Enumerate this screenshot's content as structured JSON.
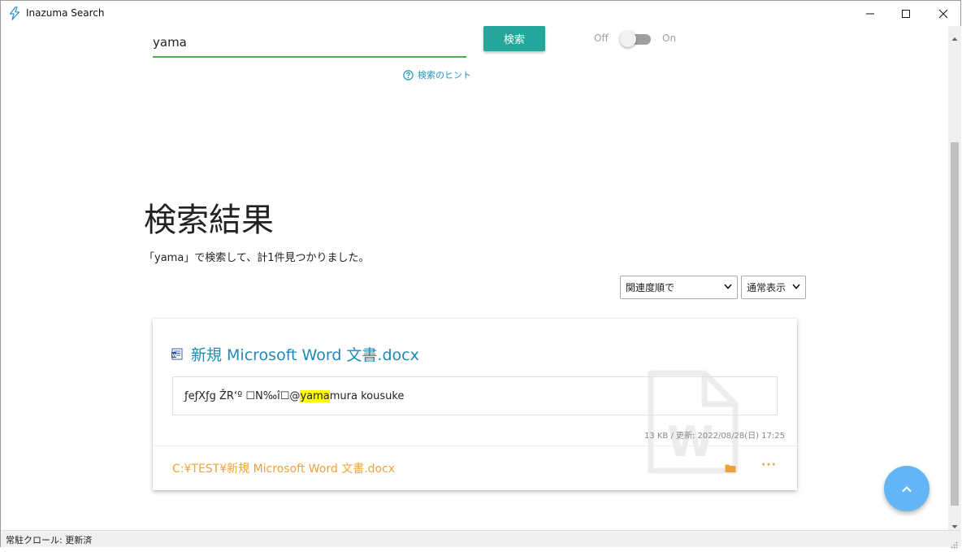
{
  "window": {
    "title": "Inazuma Search"
  },
  "search": {
    "query": "yama",
    "button_label": "検索",
    "toggle_off_label": "Off",
    "toggle_on_label": "On",
    "hint_label": "検索のヒント"
  },
  "results": {
    "heading": "検索結果",
    "summary": "「yama」で検索して、計1件見つかりました。",
    "sort_select": "関連度順で",
    "view_select": "通常表示",
    "items": [
      {
        "title": "新規 Microsoft Word 文書.docx",
        "snippet_before": "ƒeƒXƒg ŽR‘º ☐N‰î☐@",
        "snippet_highlight": "yama",
        "snippet_after": "mura kousuke",
        "meta": "13 KB / 更新: 2022/08/28(日) 17:25",
        "path": "C:¥TEST¥新規 Microsoft Word 文書.docx",
        "more_label": "···"
      }
    ]
  },
  "status": {
    "text": "常駐クロール: 更新済"
  },
  "colors": {
    "accent": "#26a69a",
    "input_underline": "#4caf50",
    "link": "#1e8ab8",
    "path": "#f0a23a",
    "fab": "#64b5f6",
    "highlight": "#ffff00"
  }
}
